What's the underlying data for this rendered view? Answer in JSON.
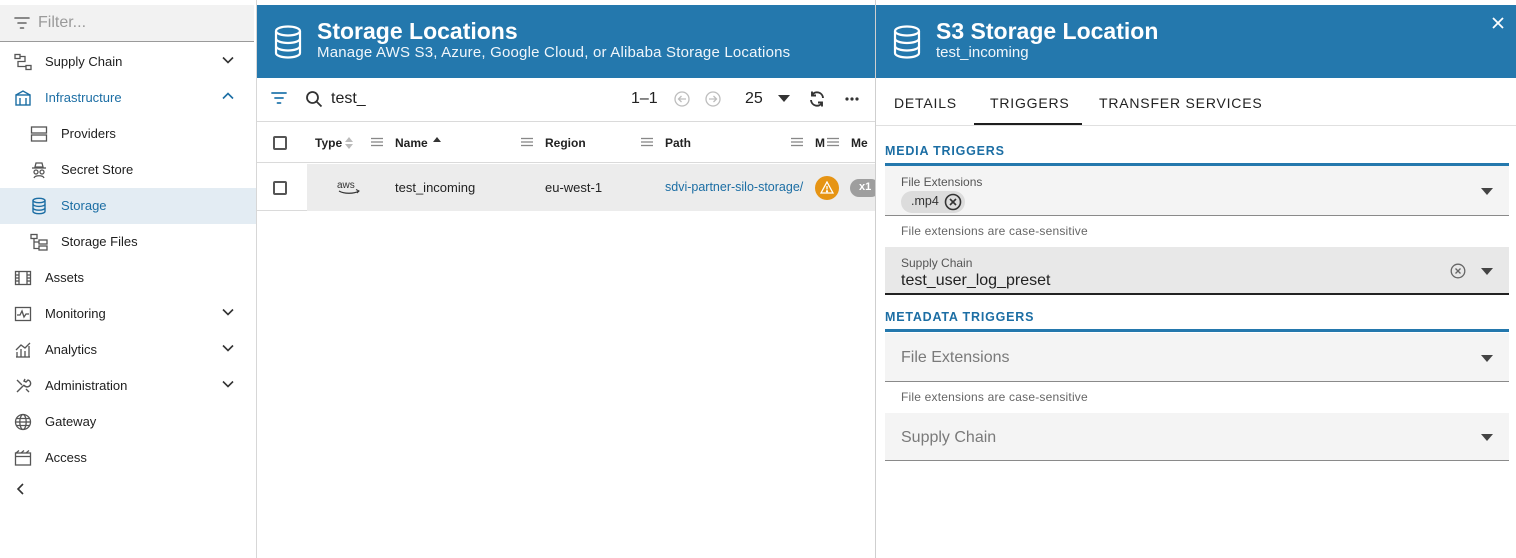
{
  "sidebar": {
    "filter_placeholder": "Filter...",
    "items": [
      {
        "label": "Supply Chain",
        "icon": "supply-chain-icon",
        "expandable": true,
        "expanded": false
      },
      {
        "label": "Infrastructure",
        "icon": "infrastructure-icon",
        "expandable": true,
        "expanded": true,
        "active": true
      },
      {
        "label": "Providers",
        "icon": "providers-icon",
        "sub": true
      },
      {
        "label": "Secret Store",
        "icon": "secret-store-icon",
        "sub": true
      },
      {
        "label": "Storage",
        "icon": "storage-icon",
        "sub": true,
        "selected": true
      },
      {
        "label": "Storage Files",
        "icon": "storage-files-icon",
        "sub": true
      },
      {
        "label": "Assets",
        "icon": "assets-icon"
      },
      {
        "label": "Monitoring",
        "icon": "monitoring-icon",
        "expandable": true
      },
      {
        "label": "Analytics",
        "icon": "analytics-icon",
        "expandable": true
      },
      {
        "label": "Administration",
        "icon": "administration-icon",
        "expandable": true
      },
      {
        "label": "Gateway",
        "icon": "globe-icon"
      },
      {
        "label": "Access",
        "icon": "access-icon"
      }
    ]
  },
  "list_panel": {
    "title": "Storage Locations",
    "subtitle": "Manage AWS S3, Azure, Google Cloud, or Alibaba Storage Locations",
    "search_query": "test_",
    "range": "1–1",
    "page_size": "25",
    "columns": [
      "Type",
      "Name",
      "Region",
      "Path",
      "M",
      "Me"
    ],
    "rows": [
      {
        "type": "aws",
        "name": "test_incoming",
        "region": "eu-west-1",
        "path": "sdvi-partner-silo-storage/",
        "count": "x1"
      }
    ]
  },
  "detail_panel": {
    "title": "S3 Storage Location",
    "subtitle": "test_incoming",
    "tabs": [
      "DETAILS",
      "TRIGGERS",
      "TRANSFER SERVICES"
    ],
    "active_tab": "TRIGGERS",
    "media": {
      "section_title": "MEDIA TRIGGERS",
      "ext_label": "File Extensions",
      "ext_chip": ".mp4",
      "ext_helper": "File extensions are case-sensitive",
      "sc_label": "Supply Chain",
      "sc_value": "test_user_log_preset"
    },
    "metadata": {
      "section_title": "METADATA TRIGGERS",
      "ext_placeholder": "File Extensions",
      "ext_helper": "File extensions are case-sensitive",
      "sc_placeholder": "Supply Chain"
    }
  },
  "colors": {
    "brand_blue": "#2478AD",
    "link_blue": "#1C6EA4",
    "warning": "#E69414",
    "selected_bg": "#E3ECF3"
  }
}
